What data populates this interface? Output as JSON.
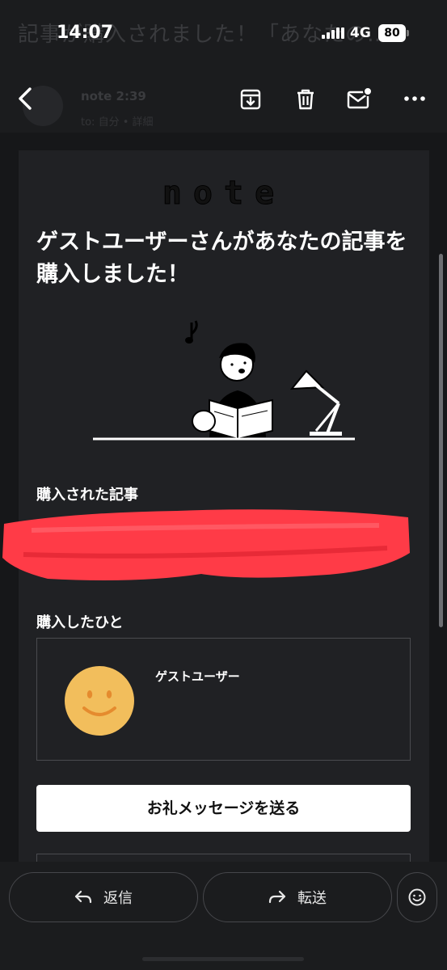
{
  "status_bar": {
    "time": "14:07",
    "network": "4G",
    "battery": "80",
    "ghost_subject": "記事が購入されました！「あなたの…"
  },
  "toolbar": {
    "ghost_sender": "note 2:39",
    "ghost_sender_detail": "to: 自分 • 詳細",
    "icons": [
      "back-icon",
      "archive-icon",
      "trash-icon",
      "mark-unread-icon",
      "more-icon"
    ]
  },
  "email": {
    "logo": "note",
    "headline": "ゲストユーザーさんがあなたの記事を購入しました！",
    "purchased_article_label": "購入された記事",
    "buyer_label": "購入したひと",
    "buyer_name": "ゲストユーザー",
    "thanks_button": "お礼メッセージを送る"
  },
  "bottom_bar": {
    "reply_label": "返信",
    "forward_label": "転送"
  },
  "colors": {
    "background": "#161719",
    "card": "#202124",
    "avatar": "#f2be5c",
    "redaction": "#ff3b47"
  }
}
